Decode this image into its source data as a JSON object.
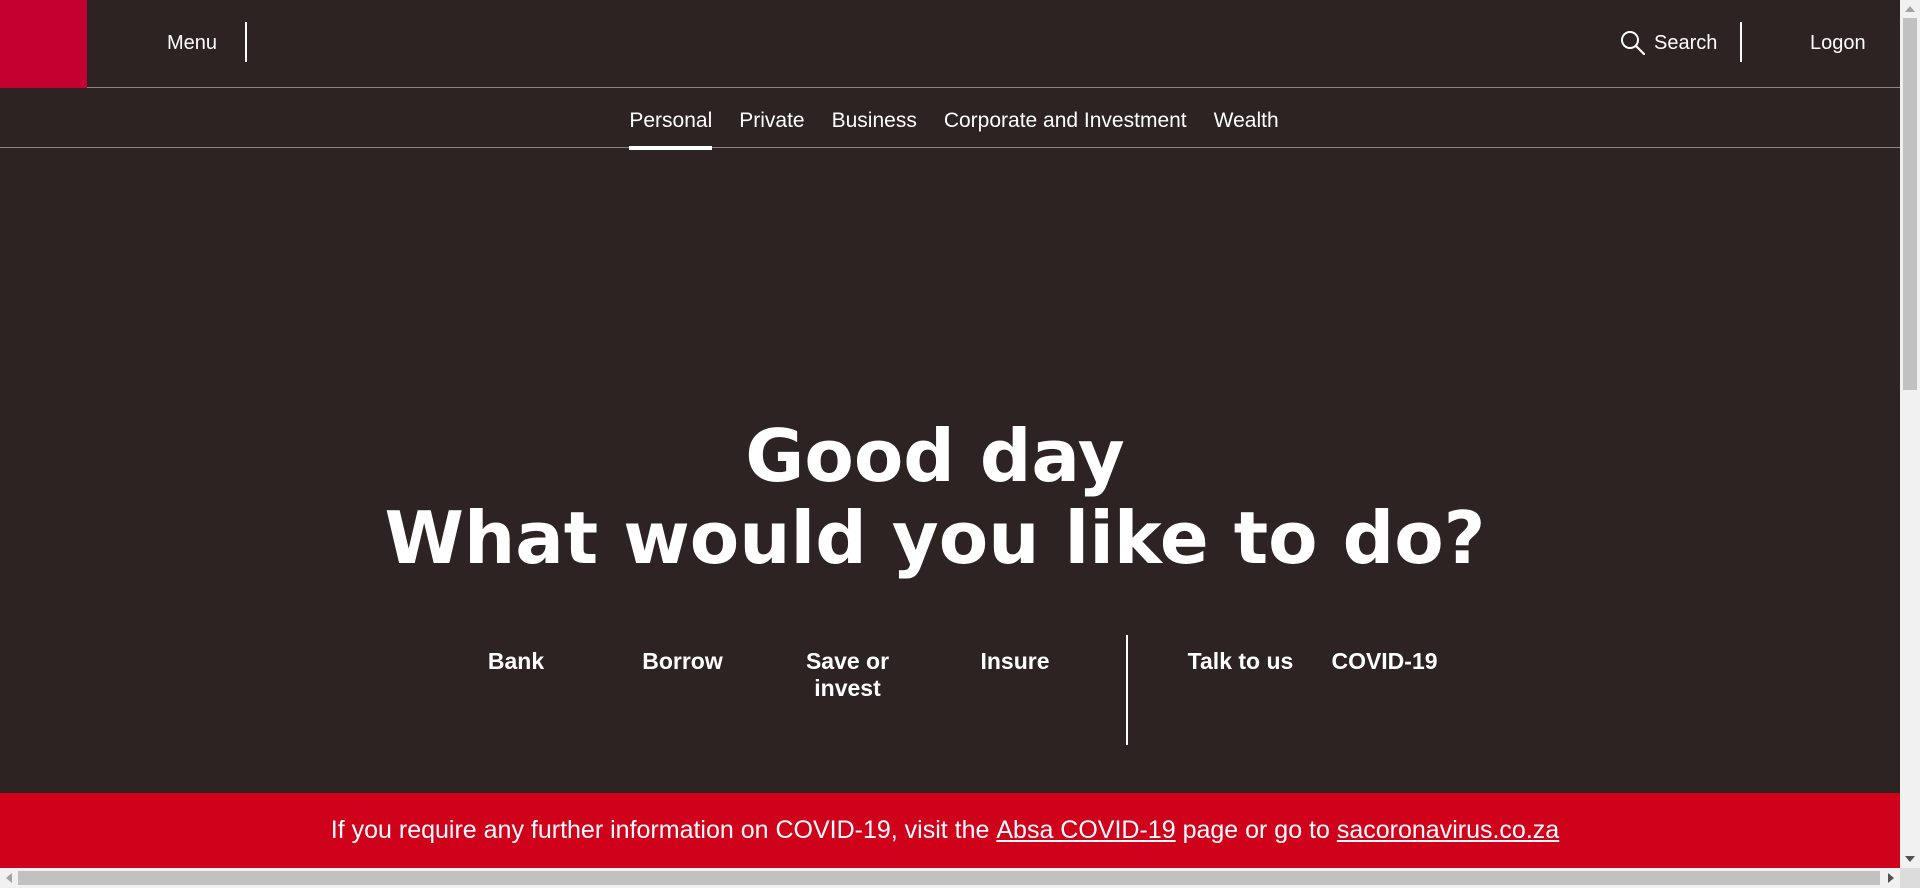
{
  "header": {
    "menu_label": "Menu",
    "search_label": "Search",
    "logon_label": "Logon",
    "brand_color": "#c3002f"
  },
  "segments": [
    {
      "label": "Personal",
      "active": true
    },
    {
      "label": "Private",
      "active": false
    },
    {
      "label": "Business",
      "active": false
    },
    {
      "label": "Corporate and Investment",
      "active": false
    },
    {
      "label": "Wealth",
      "active": false
    }
  ],
  "hero": {
    "line1": "Good day",
    "line2": "What would you like to do?"
  },
  "actions": {
    "bank": "Bank",
    "borrow": "Borrow",
    "save_line1": "Save or",
    "save_line2": "invest",
    "insure": "Insure",
    "talk": "Talk to us",
    "covid": "COVID-19"
  },
  "banner": {
    "text_before": "If you require any further information on COVID-19, visit the ",
    "link1": "Absa COVID-19",
    "text_middle": " page or go to ",
    "link2": "sacoronavirus.co.za",
    "background": "#d0021b"
  },
  "icons": {
    "search": "search-icon"
  }
}
